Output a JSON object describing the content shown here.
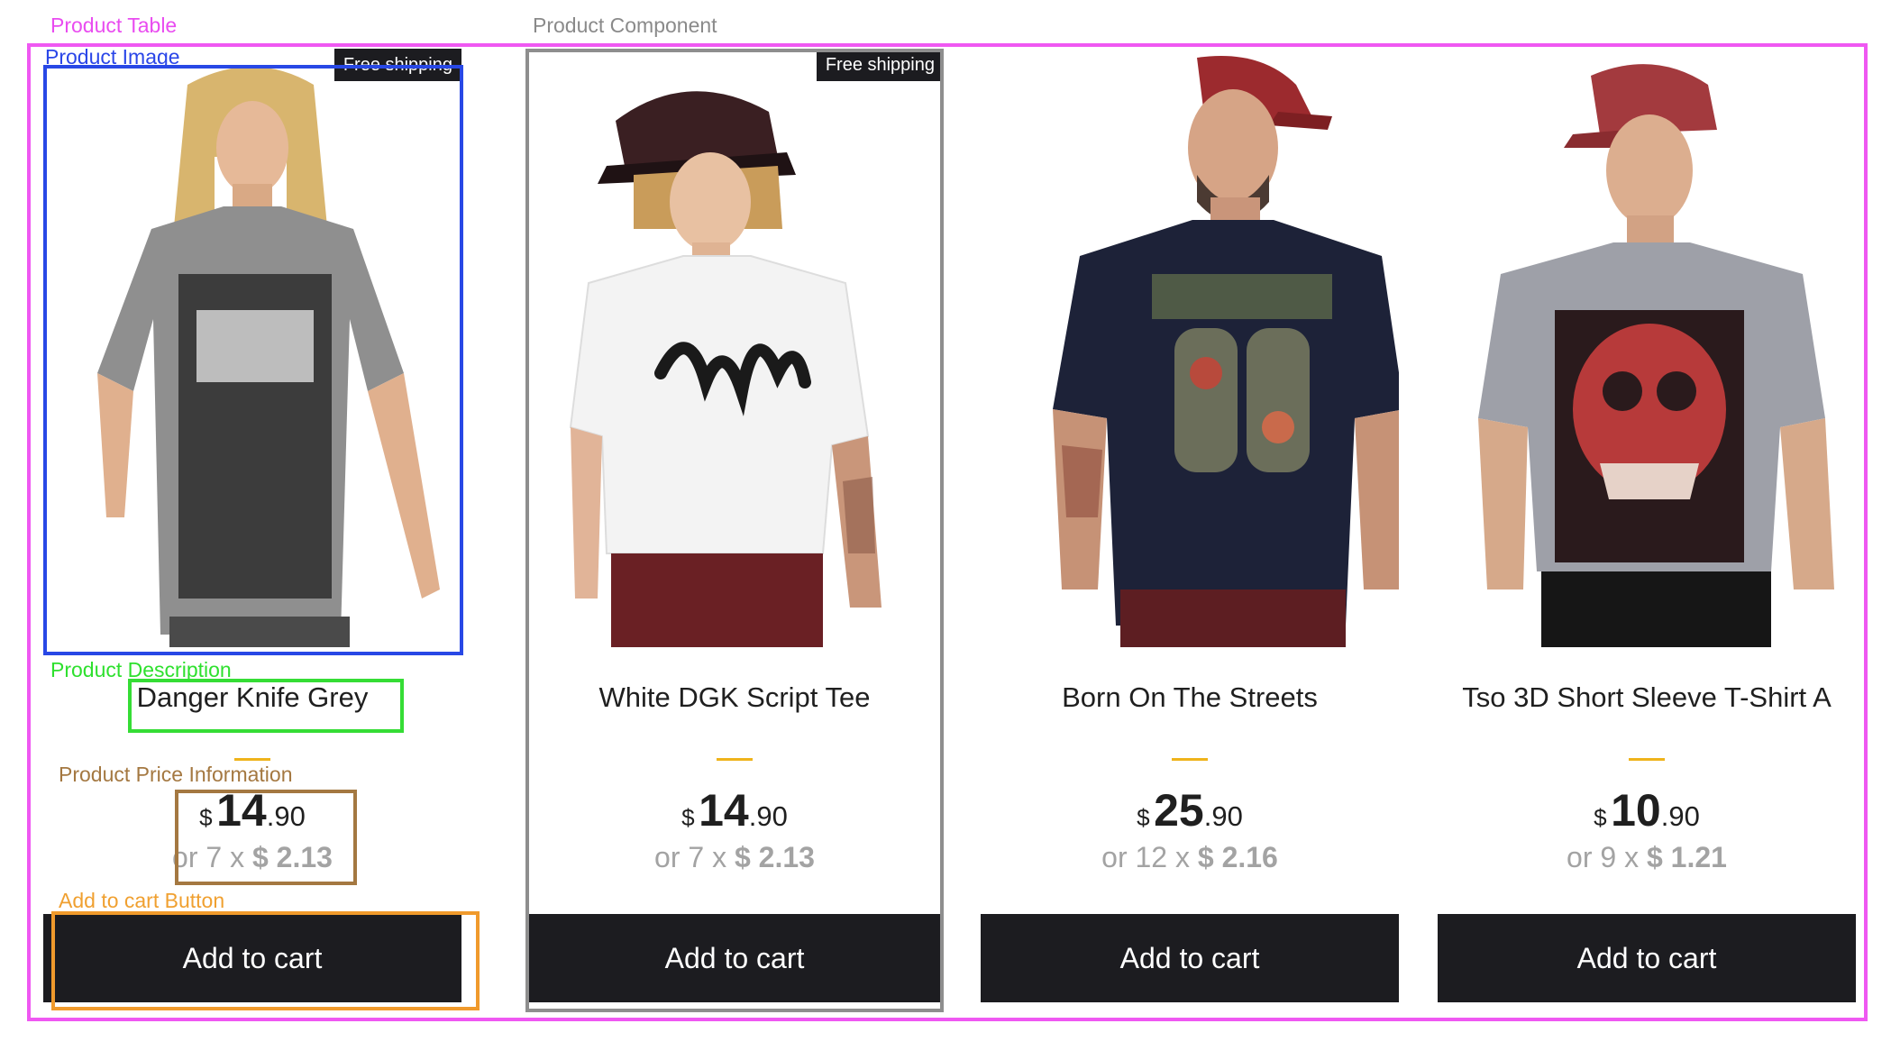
{
  "annotations": {
    "product_table": "Product Table",
    "product_component": "Product Component",
    "product_image": "Product Image",
    "product_description": "Product Description",
    "product_price_information": "Product Price Information",
    "add_to_cart_button": "Add to cart Button"
  },
  "colors": {
    "button_background": "#1c1c20",
    "divider": "#efb31b",
    "installment_text": "#a3a3a3"
  },
  "products": [
    {
      "name": "Danger Knife Grey",
      "badge": "Free shipping",
      "currency": "$",
      "price_int": "14",
      "price_dec": ".90",
      "installments_prefix": "or 7 x",
      "installment_value": "$ 2.13",
      "button": "Add to cart",
      "shirt_color": "grey",
      "image_icon": "grey-tshirt-photo"
    },
    {
      "name": "White DGK Script Tee",
      "badge": "Free shipping",
      "currency": "$",
      "price_int": "14",
      "price_dec": ".90",
      "installments_prefix": "or 7 x",
      "installment_value": "$ 2.13",
      "button": "Add to cart",
      "shirt_color": "white",
      "image_icon": "white-tshirt-photo"
    },
    {
      "name": "Born On The Streets",
      "badge": "",
      "currency": "$",
      "price_int": "25",
      "price_dec": ".90",
      "installments_prefix": "or 12 x",
      "installment_value": "$ 2.16",
      "button": "Add to cart",
      "shirt_color": "navy",
      "image_icon": "navy-tshirt-photo"
    },
    {
      "name": "Tso 3D Short Sleeve T-Shirt A",
      "badge": "",
      "currency": "$",
      "price_int": "10",
      "price_dec": ".90",
      "installments_prefix": "or 9 x",
      "installment_value": "$ 1.21",
      "button": "Add to cart",
      "shirt_color": "light-grey",
      "image_icon": "grey-graphic-tshirt-photo"
    }
  ]
}
